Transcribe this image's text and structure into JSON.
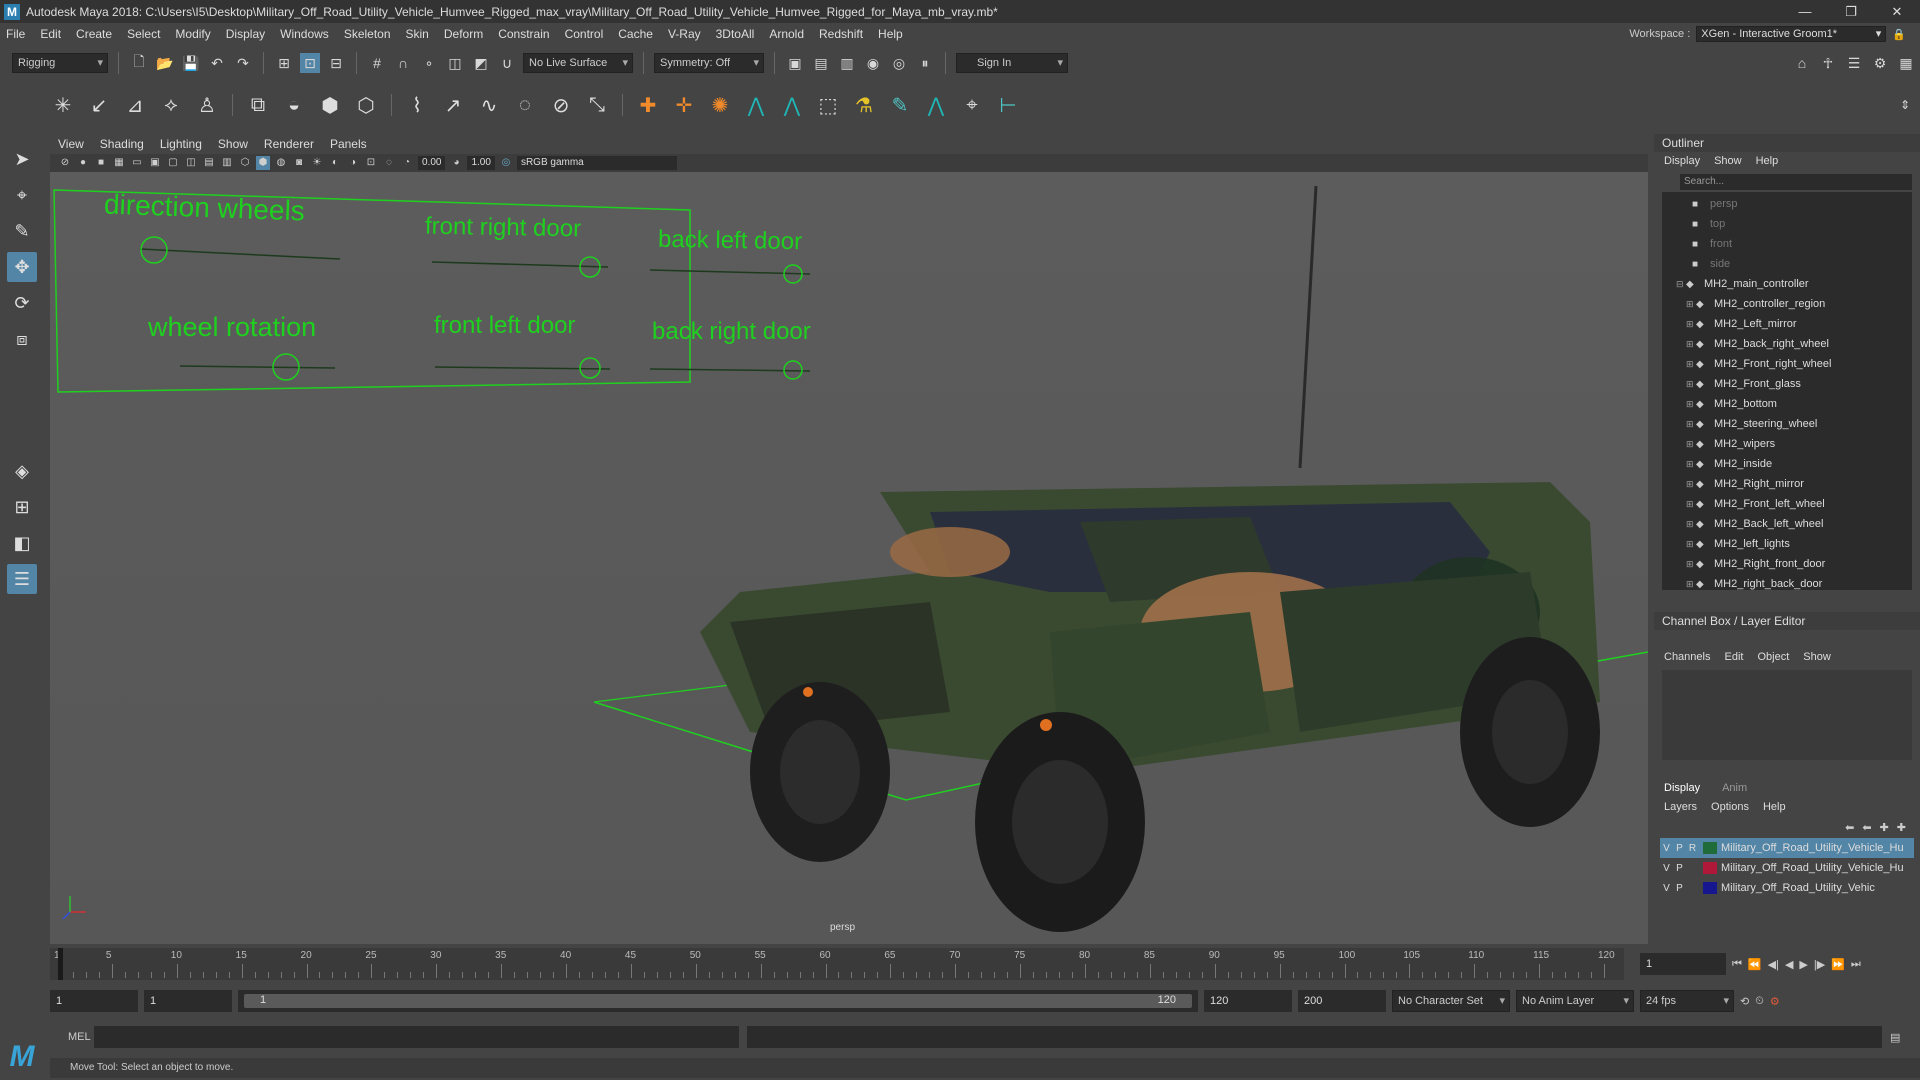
{
  "title_bar": {
    "title": "Autodesk Maya 2018: C:\\Users\\I5\\Desktop\\Military_Off_Road_Utility_Vehicle_Humvee_Rigged_max_vray\\Military_Off_Road_Utility_Vehicle_Humvee_Rigged_for_Maya_mb_vray.mb*"
  },
  "menu": [
    "File",
    "Edit",
    "Create",
    "Select",
    "Modify",
    "Display",
    "Windows",
    "Skeleton",
    "Skin",
    "Deform",
    "Constrain",
    "Control",
    "Cache",
    "V-Ray",
    "3DtoAll",
    "Arnold",
    "Redshift",
    "Help"
  ],
  "workspace": {
    "label": "Workspace :",
    "value": "XGen - Interactive Groom1*"
  },
  "status_line": {
    "mode": "Rigging",
    "live_surface": "No Live Surface",
    "symmetry": "Symmetry: Off",
    "sign_in": "Sign In"
  },
  "viewport_menu": [
    "View",
    "Shading",
    "Lighting",
    "Show",
    "Renderer",
    "Panels"
  ],
  "viewport_tools": {
    "val1": "0.00",
    "val2": "1.00",
    "color_space": "sRGB gamma"
  },
  "viewport": {
    "camera_label": "persp",
    "control_panel": {
      "direction_wheels": "direction wheels",
      "front_right_door": "front right door",
      "back_left_door": "back left door",
      "wheel_rotation": "wheel rotation",
      "front_left_door": "front left door",
      "back_right_door": "back right door"
    },
    "controller_color": "#1fd11f"
  },
  "outliner": {
    "title": "Outliner",
    "menu": [
      "Display",
      "Show",
      "Help"
    ],
    "search_placeholder": "Search...",
    "cameras": [
      "persp",
      "top",
      "front",
      "side"
    ],
    "root": "MH2_main_controller",
    "children": [
      "MH2_controller_region",
      "MH2_Left_mirror",
      "MH2_back_right_wheel",
      "MH2_Front_right_wheel",
      "MH2_Front_glass",
      "MH2_bottom",
      "MH2_steering_wheel",
      "MH2_wipers",
      "MH2_inside",
      "MH2_Right_mirror",
      "MH2_Front_left_wheel",
      "MH2_Back_left_wheel",
      "MH2_left_lights",
      "MH2_Right_front_door",
      "MH2_right_back_door"
    ]
  },
  "channel_box": {
    "title": "Channel Box / Layer Editor",
    "menu": [
      "Channels",
      "Edit",
      "Object",
      "Show"
    ]
  },
  "layer_editor": {
    "tabs": [
      "Display",
      "Anim"
    ],
    "menu": [
      "Layers",
      "Options",
      "Help"
    ],
    "layers": [
      {
        "v": "V",
        "p": "P",
        "r": "R",
        "name": "Military_Off_Road_Utility_Vehicle_Hu",
        "color": "#1f6b3a",
        "selected": true
      },
      {
        "v": "V",
        "p": "P",
        "r": "",
        "name": "Military_Off_Road_Utility_Vehicle_Hu",
        "color": "#b0183a",
        "selected": false
      },
      {
        "v": "V",
        "p": "P",
        "r": "",
        "name": "Military_Off_Road_Utility_Vehic",
        "color": "#16168f",
        "selected": false
      }
    ]
  },
  "timeline": {
    "ticks": [
      1,
      5,
      10,
      15,
      20,
      25,
      30,
      35,
      40,
      45,
      50,
      55,
      60,
      65,
      70,
      75,
      80,
      85,
      90,
      95,
      100,
      105,
      110,
      115,
      120
    ],
    "current_frame": "1"
  },
  "range": {
    "start": "1",
    "start2": "1",
    "slider_start": "1",
    "slider_end": "120",
    "end": "120",
    "end2": "200",
    "character_set": "No Character Set",
    "anim_layer": "No Anim Layer",
    "fps": "24 fps"
  },
  "command": {
    "label": "MEL"
  },
  "help_line": {
    "text": "Move Tool: Select an object to move."
  }
}
